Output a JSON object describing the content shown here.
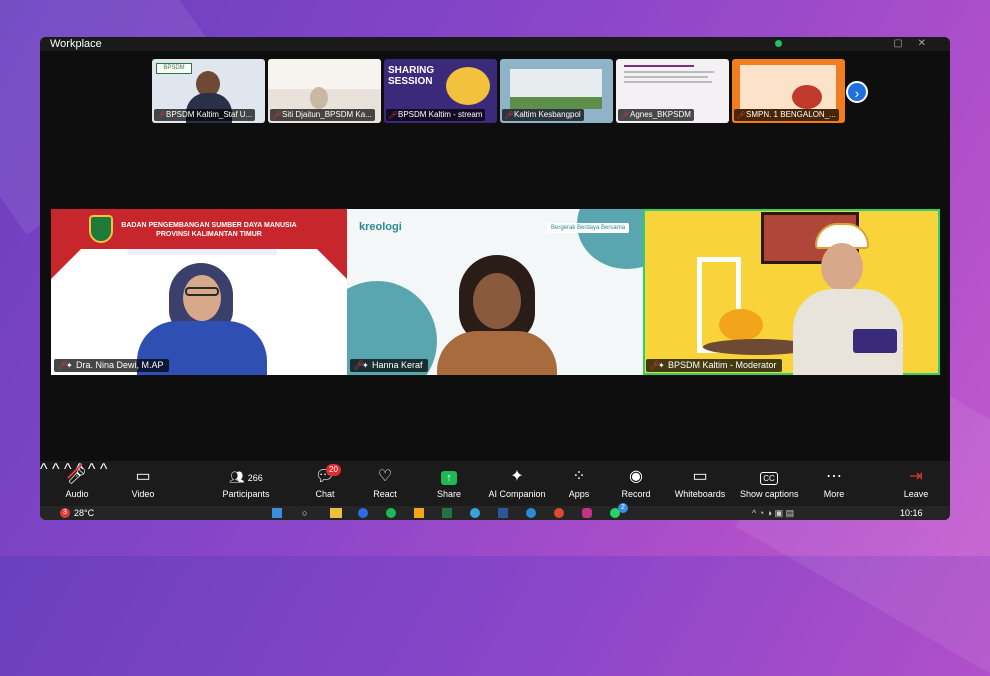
{
  "window": {
    "title": "Workplace"
  },
  "strip": {
    "thumbs": [
      {
        "name": "BPSDM Kaltim_Staf U...",
        "bg": "#dfe6ee"
      },
      {
        "name": "Siti Djaitun_BPSDM Ka...",
        "bg": "#e9e2da"
      },
      {
        "name": "BPSDM Kaltim - stream",
        "bg": "#3b2a7a",
        "heading": "SHARING SESSION"
      },
      {
        "name": "Kaltim Kesbangpol",
        "bg": "#8fb3c9"
      },
      {
        "name": "Agnes_BKPSDM",
        "bg": "#f3f1f4"
      },
      {
        "name": "SMPN. 1 BENGALON_...",
        "bg": "#f07d1f"
      }
    ]
  },
  "tiles": [
    {
      "name": "Dra. Nina Dewi, M.AP",
      "banner_line1": "BADAN PENGEMBANGAN SUMBER DAYA MANUSIA",
      "banner_line2": "PROVINSI KALIMANTAN TIMUR"
    },
    {
      "name": "Hanna Keraf",
      "logo": "kreologi",
      "tagline": "Bergerak Berdaya Bersama"
    },
    {
      "name": "BPSDM Kaltim - Moderator"
    }
  ],
  "toolbar": {
    "audio": "Audio",
    "video": "Video",
    "participants": "Participants",
    "participants_count": "266",
    "chat": "Chat",
    "chat_badge": "20",
    "react": "React",
    "share": "Share",
    "ai_companion": "AI Companion",
    "apps": "Apps",
    "record": "Record",
    "whiteboards": "Whiteboards",
    "show_captions": "Show captions",
    "captions_icon": "CC",
    "more": "More",
    "leave": "Leave"
  },
  "taskbar": {
    "weather": "28°C",
    "weather_badge": "3",
    "time": "10:16",
    "notif_badge": "2"
  },
  "colors": {
    "accent": "#1e6fe0",
    "active_speaker": "#2ed06b",
    "mute_red": "#e03a3a",
    "share_green": "#1fb955"
  }
}
